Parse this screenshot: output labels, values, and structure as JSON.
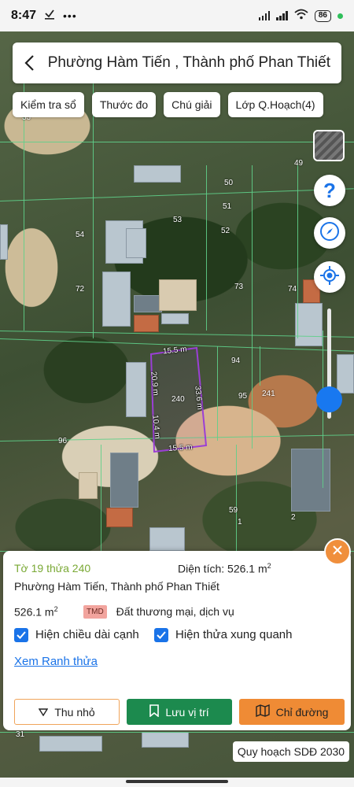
{
  "status_bar": {
    "time": "8:47",
    "battery": "86"
  },
  "header": {
    "title": "Phường Hàm Tiến , Thành phố Phan Thiết"
  },
  "chips": [
    "Kiểm tra sổ",
    "Thước đo",
    "Chú giải",
    "Lớp Q.Hoạch(4)"
  ],
  "map": {
    "plot_numbers": [
      "33",
      "49",
      "50",
      "51",
      "52",
      "53",
      "54",
      "72",
      "73",
      "74",
      "94",
      "95",
      "241",
      "96",
      "59",
      "1",
      "2",
      "31"
    ],
    "selected_parcel": {
      "number": "240",
      "edge_top": "15.5 m",
      "edge_left_upper": "20.9 m",
      "edge_left_lower": "10.4 m",
      "edge_right": "33.6 m",
      "edge_bottom": "15.5 m"
    }
  },
  "panel": {
    "sheet_parcel": "Tờ 19 thửa 240",
    "area_label": "Diện tích: 526.1 m",
    "area_superscript": "2",
    "address": "Phường Hàm Tiến, Thành phố Phan Thiết",
    "land_area": "526.1 m",
    "land_area_superscript": "2",
    "land_code": "TMD",
    "land_type": "Đất thương mại, dịch vụ",
    "check_edges": "Hiện chiều dài cạnh",
    "check_neighbors": "Hiện thửa xung quanh",
    "view_boundary_link": "Xem Ranh thửa",
    "collapse_button": "Thu nhỏ",
    "save_location_button": "Lưu vị trí",
    "directions_button": "Chỉ đường"
  },
  "planning_badge": "Quy hoạch SDĐ 2030",
  "colors": {
    "accent_blue": "#1a73e8",
    "green_button": "#1c8a4e",
    "orange_button": "#ef8b35",
    "parcel_outline": "#9b3fd6",
    "plot_lines": "#5fcf8a"
  }
}
